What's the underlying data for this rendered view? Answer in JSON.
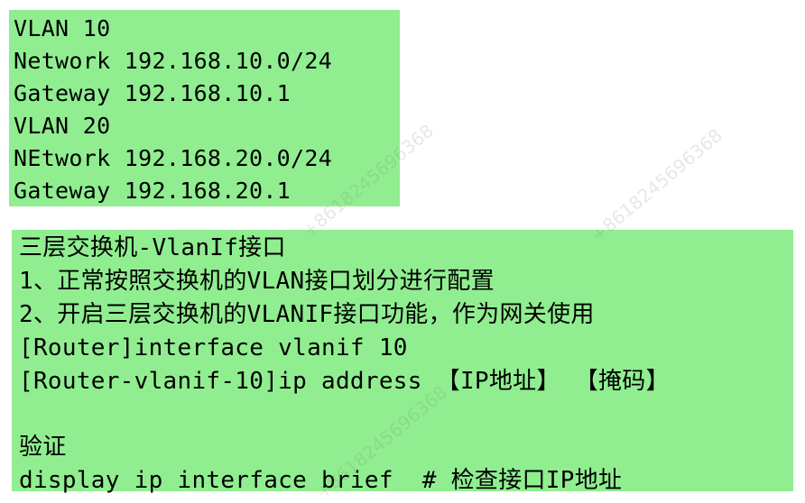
{
  "vlan_box": {
    "lines": [
      "VLAN 10",
      "Network 192.168.10.0/24",
      "Gateway 192.168.10.1",
      "VLAN 20",
      "NEtwork 192.168.20.0/24",
      "Gateway 192.168.20.1"
    ]
  },
  "vlanif_box": {
    "lines": [
      "三层交换机-VlanIf接口",
      "1、正常按照交换机的VLAN接口划分进行配置",
      "2、开启三层交换机的VLANIF接口功能，作为网关使用",
      "[Router]interface vlanif 10",
      "[Router-vlanif-10]ip address 【IP地址】 【掩码】",
      "",
      "验证",
      "display ip interface brief  # 检查接口IP地址"
    ]
  },
  "watermark": {
    "text": "+8618245696368"
  },
  "colors": {
    "box_background": "#90ee90",
    "text": "#000000"
  }
}
